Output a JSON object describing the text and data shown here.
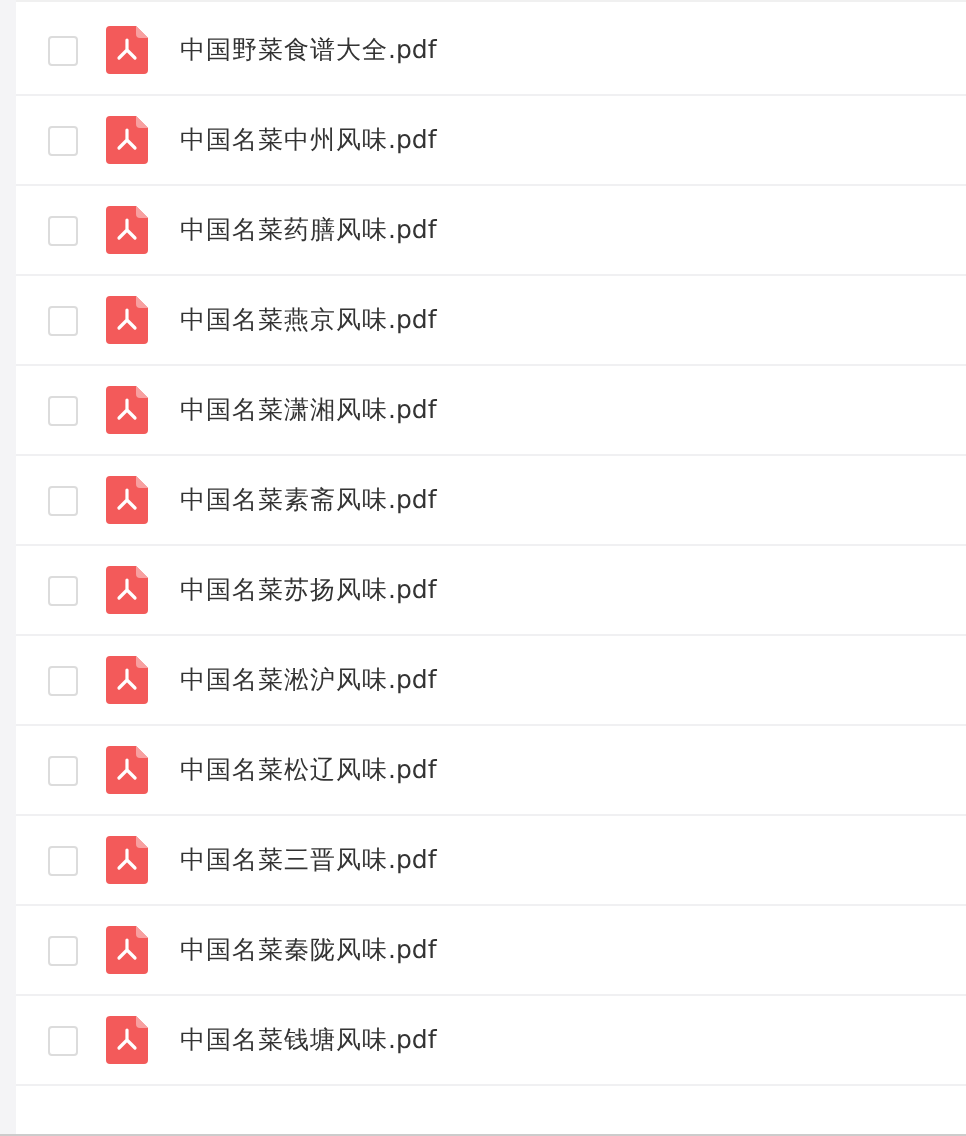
{
  "files": [
    {
      "name": "中国野菜食谱大全.pdf",
      "checked": false
    },
    {
      "name": "中国名菜中州风味.pdf",
      "checked": false
    },
    {
      "name": "中国名菜药膳风味.pdf",
      "checked": false
    },
    {
      "name": "中国名菜燕京风味.pdf",
      "checked": false
    },
    {
      "name": "中国名菜潇湘风味.pdf",
      "checked": false
    },
    {
      "name": "中国名菜素斋风味.pdf",
      "checked": false
    },
    {
      "name": "中国名菜苏扬风味.pdf",
      "checked": false
    },
    {
      "name": "中国名菜淞沪风味.pdf",
      "checked": false
    },
    {
      "name": "中国名菜松辽风味.pdf",
      "checked": false
    },
    {
      "name": "中国名菜三晋风味.pdf",
      "checked": false
    },
    {
      "name": "中国名菜秦陇风味.pdf",
      "checked": false
    },
    {
      "name": "中国名菜钱塘风味.pdf",
      "checked": false
    }
  ]
}
